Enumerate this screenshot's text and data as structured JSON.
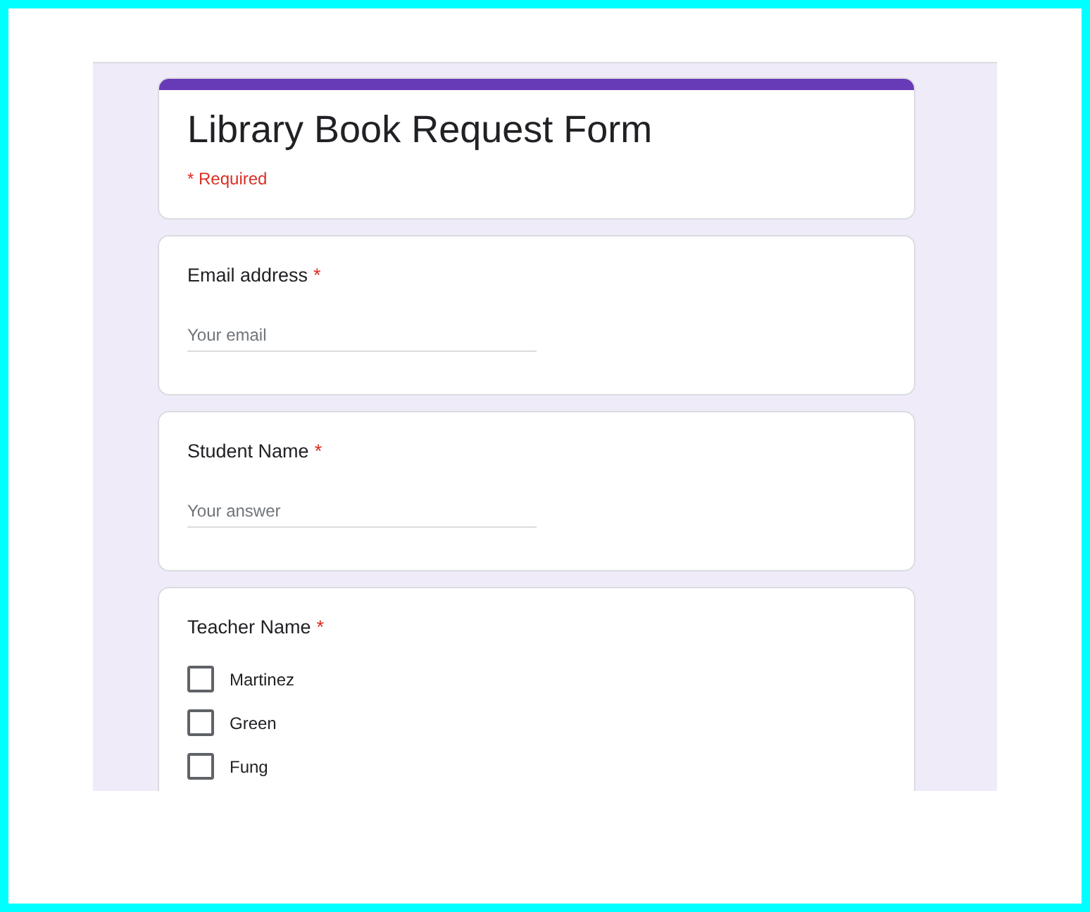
{
  "form": {
    "title": "Library Book Request Form",
    "required_note": "* Required",
    "required_mark": "*"
  },
  "questions": [
    {
      "kind": "text",
      "label": "Email address",
      "required": true,
      "placeholder": "Your email"
    },
    {
      "kind": "text",
      "label": "Student Name",
      "required": true,
      "placeholder": "Your answer"
    },
    {
      "kind": "checkbox",
      "label": "Teacher Name",
      "required": true,
      "options": [
        {
          "label": "Martinez",
          "checked": false
        },
        {
          "label": "Green",
          "checked": false
        },
        {
          "label": "Fung",
          "checked": false
        }
      ]
    }
  ]
}
